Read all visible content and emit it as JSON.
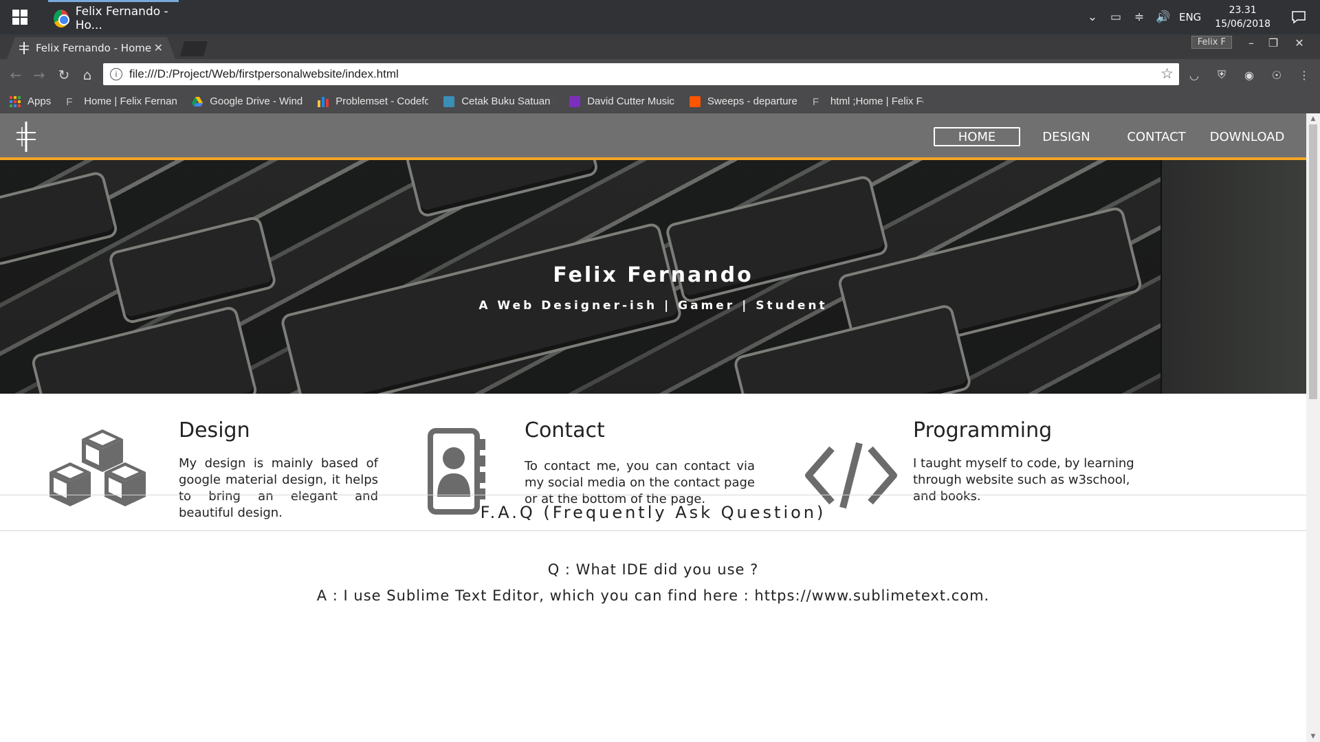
{
  "taskbar": {
    "app_title": "Felix Fernando - Ho...",
    "language": "ENG",
    "time": "23.31",
    "date": "15/06/2018"
  },
  "browser": {
    "tab_title": "Felix Fernando - Home",
    "profile_name": "Felix F",
    "url": "file:///D:/Project/Web/firstpersonalwebsite/index.html",
    "bookmarks": [
      {
        "label": "Apps",
        "icon": "apps-grid-icon"
      },
      {
        "label": "Home | Felix Fernando",
        "icon": "f-logo-icon"
      },
      {
        "label": "Google Drive - Windows",
        "icon": "google-drive-icon"
      },
      {
        "label": "Problemset - Codeforces",
        "icon": "codeforces-icon"
      },
      {
        "label": "Cetak Buku Satuan |",
        "icon": "book-icon"
      },
      {
        "label": "David Cutter Music",
        "icon": "music-icon"
      },
      {
        "label": "Sweeps - departure",
        "icon": "soundcloud-icon"
      },
      {
        "label": "html ;Home | Felix Fernando",
        "icon": "f-logo-icon"
      }
    ]
  },
  "site": {
    "nav": [
      "HOME",
      "DESIGN",
      "CONTACT",
      "DOWNLOAD"
    ],
    "hero": {
      "title": "Felix Fernando",
      "subtitle": "A Web Designer-ish | Gamer | Student"
    },
    "features": [
      {
        "title": "Design",
        "text": "My design is mainly based of google material design, it helps to bring an elegant and beautiful design.",
        "icon": "cubes-icon"
      },
      {
        "title": "Contact",
        "text": "To contact me, you can contact via my social media on the contact page or at the bottom of the page.",
        "icon": "address-book-icon"
      },
      {
        "title": "Programming",
        "text": "I taught myself to code, by learning through website such as w3school, and books.",
        "icon": "code-icon"
      }
    ],
    "faq": {
      "title": "F.A.Q (Frequently Ask Question)",
      "question": "Q : What IDE did you use ?",
      "answer": "A : I use Sublime Text Editor, which you can find here : https://www.sublimetext.com."
    }
  },
  "colors": {
    "nav_bg": "#707070",
    "nav_accent": "#f5a623",
    "icon_gray": "#6b6b6b"
  }
}
